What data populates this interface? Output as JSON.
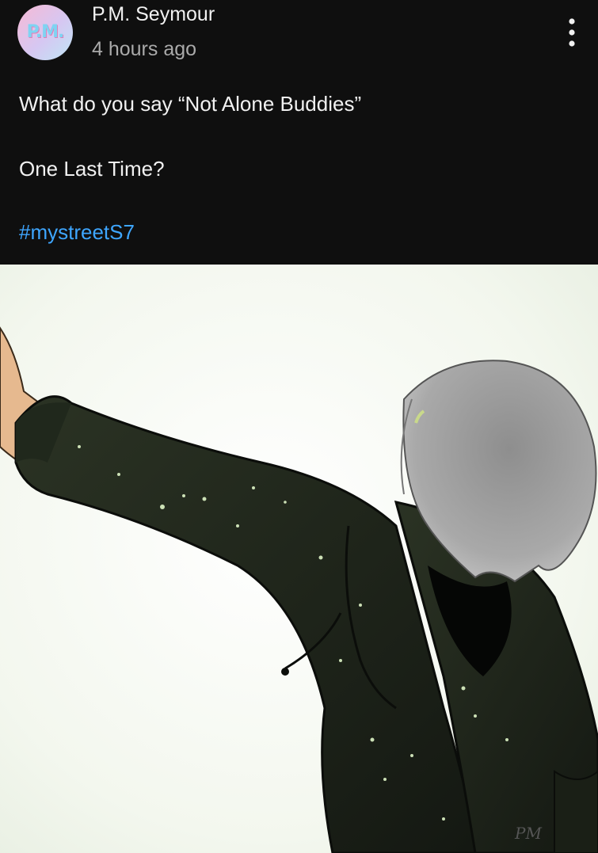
{
  "post": {
    "author": {
      "name": "P.M. Seymour",
      "avatar_text": "P.M."
    },
    "timestamp": "4 hours ago",
    "lines": [
      "What do you say “Not Alone Buddies”",
      "One Last Time?"
    ],
    "hashtag": "#mystreetS7",
    "menu_icon": "more-vert-icon",
    "image": {
      "description_icon": "artwork-image",
      "signature": "PM"
    }
  },
  "colors": {
    "background": "#0f0f0f",
    "text_primary": "#f1f1f1",
    "text_secondary": "#aaaaaa",
    "hashtag": "#3ea6ff"
  }
}
